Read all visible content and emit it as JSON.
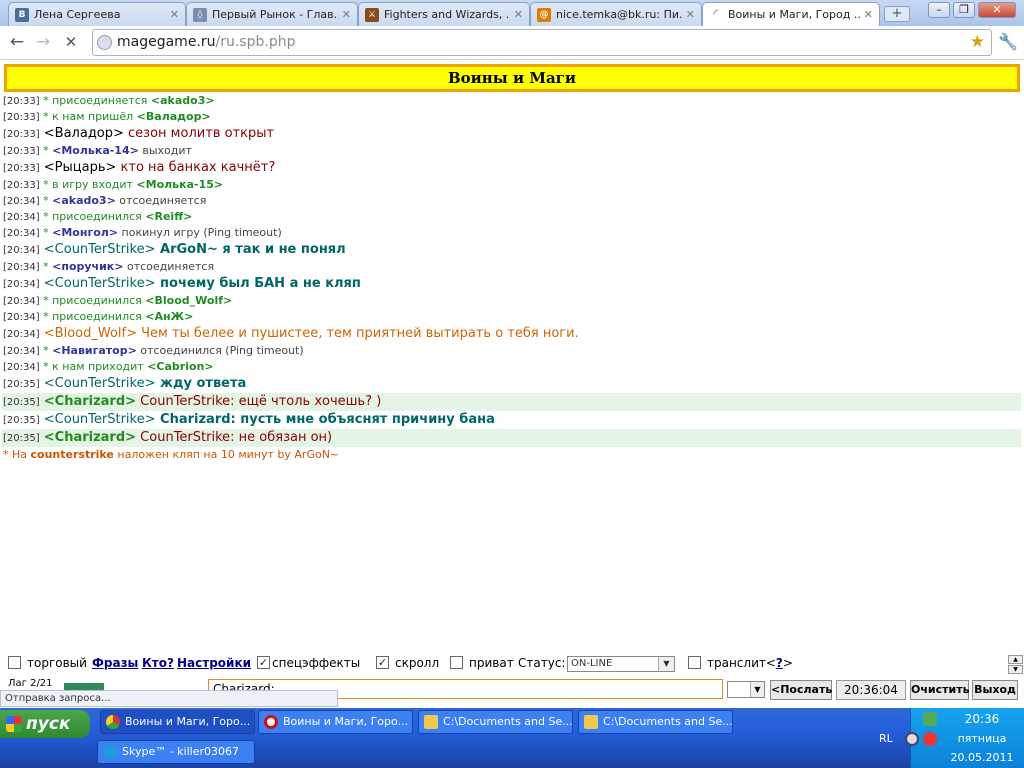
{
  "browser": {
    "tabs": [
      {
        "title": "Лена Сергеева",
        "icon": "vk-icon",
        "icon_color": "#4a6e9c",
        "active": false
      },
      {
        "title": "Первый Рынок - Глав...",
        "icon": "market-icon",
        "icon_color": "#7a8fb0",
        "active": false
      },
      {
        "title": "Fighters and Wizards, ...",
        "icon": "game-icon",
        "icon_color": "#8b4a1a",
        "active": false
      },
      {
        "title": "nice.temka@bk.ru: Пи...",
        "icon": "mail-icon",
        "icon_color": "#e07b00",
        "active": false
      },
      {
        "title": "Воины и Маги, Город ...",
        "icon": "loading-icon",
        "icon_color": "#5577aa",
        "active": true
      }
    ],
    "url_host": "magegame.ru",
    "url_path": "/ru.spb.php"
  },
  "page": {
    "banner_title": "Воины и Маги"
  },
  "chat": {
    "messages": [
      {
        "time": "[20:33]",
        "pre": " * присоединяется ",
        "nick": "<akado3>",
        "nick_style": "green",
        "text": "",
        "big": false,
        "hl": false
      },
      {
        "time": "[20:33]",
        "pre": " * к нам пришёл ",
        "nick": "<Валадор>",
        "nick_style": "green",
        "text": "",
        "big": false,
        "hl": false
      },
      {
        "time": "[20:33]",
        "pre": " ",
        "nick": "<Валадор>",
        "nick_style": "black",
        "text": " сезон молитв открыт",
        "text_style": "red",
        "big": true,
        "hl": false
      },
      {
        "time": "[20:33]",
        "pre": " * ",
        "nick": "<Молька-14>",
        "nick_style": "dblue",
        "text": " выходит",
        "text_style": "grey",
        "big": false,
        "hl": false
      },
      {
        "time": "[20:33]",
        "pre": " ",
        "nick": "<Рыцарь>",
        "nick_style": "black",
        "text": " кто на банках качнёт?",
        "text_style": "red",
        "big": true,
        "hl": false
      },
      {
        "time": "[20:33]",
        "pre": " * в игру входит ",
        "nick": "<Молька-15>",
        "nick_style": "green",
        "text": "",
        "big": false,
        "hl": false
      },
      {
        "time": "[20:34]",
        "pre": " * ",
        "nick": "<akado3>",
        "nick_style": "dblue",
        "text": " отсоединяется",
        "text_style": "grey",
        "big": false,
        "hl": false
      },
      {
        "time": "[20:34]",
        "pre": " * присоединился ",
        "nick": "<Reiff>",
        "nick_style": "green",
        "text": "",
        "big": false,
        "hl": false
      },
      {
        "time": "[20:34]",
        "pre": " * ",
        "nick": "<Монгол>",
        "nick_style": "dblue",
        "text": " покинул игру (Ping timeout)",
        "text_style": "grey",
        "big": false,
        "hl": false
      },
      {
        "time": "[20:34]",
        "pre": " ",
        "nick": "<CounTerStrike>",
        "nick_style": "teal",
        "text": " ArGoN~ я так и не понял",
        "text_style": "teal",
        "big": true,
        "hl": false
      },
      {
        "time": "[20:34]",
        "pre": " * ",
        "nick": "<поручик>",
        "nick_style": "dblue",
        "text": " отсоединяется",
        "text_style": "grey",
        "big": false,
        "hl": false
      },
      {
        "time": "[20:34]",
        "pre": " ",
        "nick": "<CounTerStrike>",
        "nick_style": "teal",
        "text": " почему был БАН а не кляп",
        "text_style": "teal",
        "big": true,
        "hl": false
      },
      {
        "time": "[20:34]",
        "pre": " * присоединился ",
        "nick": "<Blood_Wolf>",
        "nick_style": "green",
        "text": "",
        "big": false,
        "hl": false
      },
      {
        "time": "[20:34]",
        "pre": " * присоединился ",
        "nick": "<АнЖ>",
        "nick_style": "green",
        "text": "",
        "big": false,
        "hl": false
      },
      {
        "time": "[20:34]",
        "pre": " ",
        "nick": "<Blood_Wolf>",
        "nick_style": "orange",
        "text": " Чем ты белее и пушистее, тем приятней вытирать о тебя ноги.",
        "text_style": "orange",
        "big": true,
        "hl": false
      },
      {
        "time": "[20:34]",
        "pre": " * ",
        "nick": "<Навигатор>",
        "nick_style": "dblue",
        "text": " отсоединился (Ping timeout)",
        "text_style": "grey",
        "big": false,
        "hl": false
      },
      {
        "time": "[20:34]",
        "pre": " * к нам приходит ",
        "nick": "<Cabrion>",
        "nick_style": "green",
        "text": "",
        "big": false,
        "hl": false
      },
      {
        "time": "[20:35]",
        "pre": " ",
        "nick": "<CounTerStrike>",
        "nick_style": "teal",
        "text": " жду ответа",
        "text_style": "teal",
        "big": true,
        "hl": false
      },
      {
        "time": "[20:35]",
        "pre": " ",
        "nick": "<Charizard>",
        "nick_style": "green",
        "text": " CounTerStrike: ещё чтоль хочешь? )",
        "text_style": "red",
        "big": true,
        "hl": true
      },
      {
        "time": "[20:35]",
        "pre": " ",
        "nick": "<CounTerStrike>",
        "nick_style": "teal",
        "text": " Charizard: пусть мне объяснят причину бана",
        "text_style": "teal",
        "big": true,
        "hl": false
      },
      {
        "time": "[20:35]",
        "pre": " ",
        "nick": "<Charizard>",
        "nick_style": "green",
        "text": " CounTerStrike: не обязан он)",
        "text_style": "red",
        "big": true,
        "hl": true
      }
    ],
    "system_prefix": "* На ",
    "system_nick": "counterstrike",
    "system_text": " наложен кляп на 10 минут by ArGoN~"
  },
  "controls": {
    "trade_label": "торговый",
    "phrases_link": "Фразы",
    "who_link": "Кто?",
    "settings_link": "Настройки",
    "effects_label": "спецэффекты",
    "scroll_label": "скролл",
    "private_label": "приват",
    "status_label": "Статус:",
    "status_value": "ON-LINE",
    "translit_label": "транслит<",
    "translit_q": "?",
    "translit_end": ">",
    "trade_checked": false,
    "effects_checked": true,
    "scroll_checked": true,
    "private_checked": false,
    "translit_checked": false
  },
  "inputbar": {
    "lag_text": "Лаг 2/21",
    "message_value": "Charizard:",
    "send_label": "<Послать",
    "clock": "20:36:04",
    "clear_label": "Очистить",
    "exit_label": "Выход"
  },
  "status_bubble": "Отправка запроса...",
  "taskbar": {
    "start_label": "пуск",
    "tasks": [
      {
        "label": "Воины и Маги, Горо...",
        "icon": "chrome-icon",
        "icon_color": "#e8b838",
        "active": true
      },
      {
        "label": "Воины и Маги, Горо...",
        "icon": "opera-icon",
        "icon_color": "#d01010",
        "active": false
      },
      {
        "label": "C:\\Documents and Se...",
        "icon": "folder-icon",
        "icon_color": "#f0c850",
        "active": false
      },
      {
        "label": "C:\\Documents and Se...",
        "icon": "folder-icon",
        "icon_color": "#f0c850",
        "active": false
      },
      {
        "label": "Skype™ - killer03067",
        "icon": "skype-icon",
        "icon_color": "#1e9be0",
        "active": false
      }
    ],
    "lang": "RL",
    "time": "20:36",
    "day": "пятница",
    "date": "20.05.2011"
  }
}
